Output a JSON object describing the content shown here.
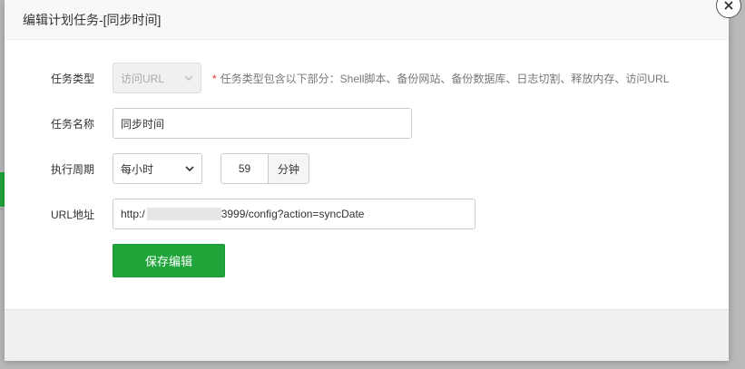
{
  "dialog": {
    "title": "编辑计划任务-[同步时间]"
  },
  "form": {
    "task_type": {
      "label": "任务类型",
      "value": "访问URL",
      "hint_star": "*",
      "hint": "任务类型包含以下部分：Shell脚本、备份网站、备份数据库、日志切割、释放内存、访问URL"
    },
    "task_name": {
      "label": "任务名称",
      "value": "同步时间"
    },
    "period": {
      "label": "执行周期",
      "value": "每小时",
      "minute_value": "59",
      "minute_unit": "分钟"
    },
    "url": {
      "label": "URL地址",
      "value_prefix": "http:/",
      "value_suffix": "3999/config?action=syncDate"
    }
  },
  "actions": {
    "save_label": "保存编辑"
  },
  "colors": {
    "primary_green": "#20a53a",
    "required_star": "#e33333"
  },
  "icons": {
    "close": "close-icon",
    "dropdown": "chevron-down-icon"
  }
}
